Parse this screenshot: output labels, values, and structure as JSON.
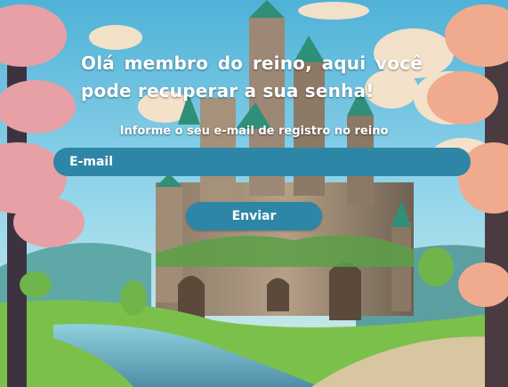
{
  "page": {
    "headline": "Olá membro do reino, aqui você pode recuperar a sua senha!",
    "hint": "Informe o seu e-mail de registro no reino"
  },
  "form": {
    "email_placeholder": "E-mail",
    "email_value": "",
    "submit_label": "Enviar"
  },
  "colors": {
    "accent": "#2e86a6",
    "text": "#ffffff"
  }
}
